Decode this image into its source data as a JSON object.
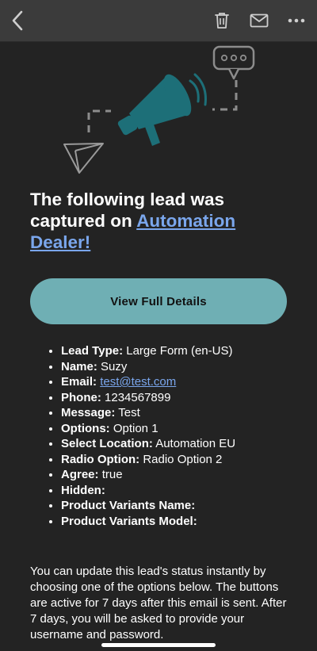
{
  "toolbar": {
    "icons": [
      "chevron-left-icon",
      "trash-icon",
      "mail-icon",
      "more-horizontal-icon"
    ]
  },
  "email": {
    "headline_prefix": "The following lead was captured on ",
    "headline_link": "Automation Dealer!",
    "cta_label": "View Full Details",
    "details": [
      {
        "label": "Lead Type:",
        "value": "Large Form (en-US)"
      },
      {
        "label": "Name:",
        "value": "Suzy"
      },
      {
        "label": "Email:",
        "value": "test@test.com",
        "link": true
      },
      {
        "label": "Phone:",
        "value": "1234567899"
      },
      {
        "label": "Message:",
        "value": "Test"
      },
      {
        "label": "Options:",
        "value": "Option 1"
      },
      {
        "label": "Select Location:",
        "value": "Automation EU"
      },
      {
        "label": "Radio Option:",
        "value": "Radio Option 2"
      },
      {
        "label": "Agree:",
        "value": "true"
      },
      {
        "label": "Hidden:",
        "value": ""
      },
      {
        "label": "Product Variants Name:",
        "value": ""
      },
      {
        "label": "Product Variants Model:",
        "value": ""
      }
    ],
    "note": "You can update this lead's status instantly by choosing one of the options below. The buttons are active for 7 days after this email is sent. After 7 days, you will be asked to provide your username and password."
  },
  "colors": {
    "background": "#232323",
    "toolbar": "#3b3b3b",
    "accent_teal": "#6fafb4",
    "megaphone": "#1d6f78",
    "link": "#7aa6ec"
  }
}
